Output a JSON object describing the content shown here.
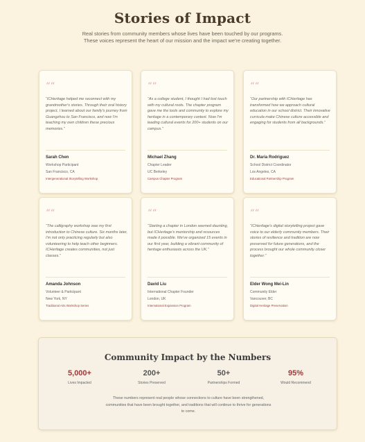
{
  "page": {
    "title": "Stories of Impact",
    "intro": "Real stories from community members whose lives have been touched by our programs. These voices represent the heart of our mission and the impact we're creating together."
  },
  "testimonials": [
    {
      "quote": "“ICHeritage helped me reconnect with my grandmother's stories. Through their oral history project, I learned about our family's journey from Guangzhou to San Francisco, and now I'm teaching my own children these precious memories.”",
      "name": "Sarah Chen",
      "role": "Workshop Participant",
      "location": "San Francisco, CA",
      "program": "Intergenerational Storytelling Workshop"
    },
    {
      "quote": "“As a college student, I thought I had lost touch with my cultural roots. The chapter program gave me the tools and community to explore my heritage in a contemporary context. Now I'm leading cultural events for 200+ students on our campus.”",
      "name": "Michael Zhang",
      "role": "Chapter Leader",
      "location": "UC Berkeley",
      "program": "Campus Chapter Program"
    },
    {
      "quote": "“Our partnership with ICHeritage has transformed how we approach cultural education in our school district. Their innovative curricula make Chinese culture accessible and engaging for students from all backgrounds.”",
      "name": "Dr. Maria Rodriguez",
      "role": "School District Coordinator",
      "location": "Los Angeles, CA",
      "program": "Educational Partnership Program"
    },
    {
      "quote": "“The calligraphy workshop was my first introduction to Chinese culture. Six months later, I'm not only practicing regularly but also volunteering to help teach other beginners. ICHeritage creates communities, not just classes.”",
      "name": "Amanda Johnson",
      "role": "Volunteer & Participant",
      "location": "New York, NY",
      "program": "Traditional Arts Workshop Series"
    },
    {
      "quote": "“Starting a chapter in London seemed daunting, but ICHeritage's mentorship and resources made it possible. We've organized 15 events in our first year, building a vibrant community of heritage enthusiasts across the UK.”",
      "name": "David Liu",
      "role": "International Chapter Founder",
      "location": "London, UK",
      "program": "International Expansion Program"
    },
    {
      "quote": "“ICHeritage's digital storytelling project gave voice to our elderly community members. Their stories of resilience and tradition are now preserved for future generations, and the process brought our whole community closer together.”",
      "name": "Elder Wong Mei-Lin",
      "role": "Community Elder",
      "location": "Vancouver, BC",
      "program": "Digital Heritage Preservation"
    }
  ],
  "quote_mark": "““",
  "impact": {
    "title": "Community Impact by the Numbers",
    "stats": [
      {
        "value": "5,000+",
        "label": "Lives Impacted",
        "color": "#9b3a3a"
      },
      {
        "value": "200+",
        "label": "Stories Preserved",
        "color": "#555555"
      },
      {
        "value": "50+",
        "label": "Partnerships Formed",
        "color": "#555555"
      },
      {
        "value": "95%",
        "label": "Would Recommend",
        "color": "#9b3a3a"
      }
    ],
    "note": "These numbers represent real people whose connections to culture have been strengthened, communities that have been brought together, and traditions that will continue to thrive for generations to come."
  },
  "colors": {
    "background": "#fbf3df",
    "accent_red": "#9b3a3a",
    "quote_pink": "#e3a7ad"
  }
}
